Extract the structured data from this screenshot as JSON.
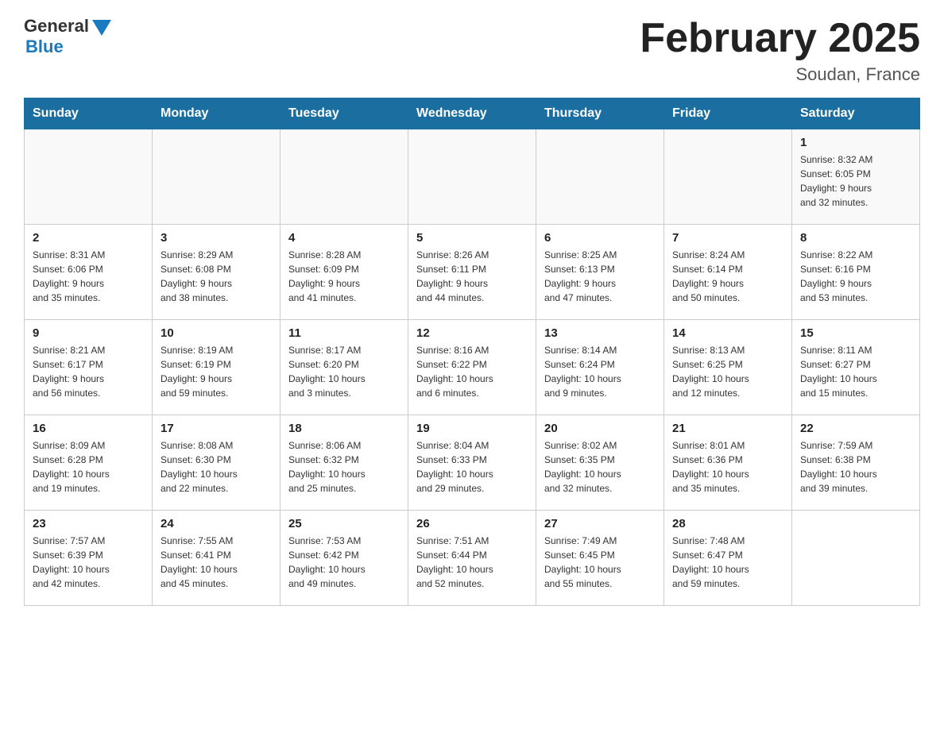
{
  "header": {
    "logo_general": "General",
    "logo_blue": "Blue",
    "month_title": "February 2025",
    "location": "Soudan, France"
  },
  "weekdays": [
    "Sunday",
    "Monday",
    "Tuesday",
    "Wednesday",
    "Thursday",
    "Friday",
    "Saturday"
  ],
  "weeks": [
    [
      {
        "day": "",
        "info": ""
      },
      {
        "day": "",
        "info": ""
      },
      {
        "day": "",
        "info": ""
      },
      {
        "day": "",
        "info": ""
      },
      {
        "day": "",
        "info": ""
      },
      {
        "day": "",
        "info": ""
      },
      {
        "day": "1",
        "info": "Sunrise: 8:32 AM\nSunset: 6:05 PM\nDaylight: 9 hours\nand 32 minutes."
      }
    ],
    [
      {
        "day": "2",
        "info": "Sunrise: 8:31 AM\nSunset: 6:06 PM\nDaylight: 9 hours\nand 35 minutes."
      },
      {
        "day": "3",
        "info": "Sunrise: 8:29 AM\nSunset: 6:08 PM\nDaylight: 9 hours\nand 38 minutes."
      },
      {
        "day": "4",
        "info": "Sunrise: 8:28 AM\nSunset: 6:09 PM\nDaylight: 9 hours\nand 41 minutes."
      },
      {
        "day": "5",
        "info": "Sunrise: 8:26 AM\nSunset: 6:11 PM\nDaylight: 9 hours\nand 44 minutes."
      },
      {
        "day": "6",
        "info": "Sunrise: 8:25 AM\nSunset: 6:13 PM\nDaylight: 9 hours\nand 47 minutes."
      },
      {
        "day": "7",
        "info": "Sunrise: 8:24 AM\nSunset: 6:14 PM\nDaylight: 9 hours\nand 50 minutes."
      },
      {
        "day": "8",
        "info": "Sunrise: 8:22 AM\nSunset: 6:16 PM\nDaylight: 9 hours\nand 53 minutes."
      }
    ],
    [
      {
        "day": "9",
        "info": "Sunrise: 8:21 AM\nSunset: 6:17 PM\nDaylight: 9 hours\nand 56 minutes."
      },
      {
        "day": "10",
        "info": "Sunrise: 8:19 AM\nSunset: 6:19 PM\nDaylight: 9 hours\nand 59 minutes."
      },
      {
        "day": "11",
        "info": "Sunrise: 8:17 AM\nSunset: 6:20 PM\nDaylight: 10 hours\nand 3 minutes."
      },
      {
        "day": "12",
        "info": "Sunrise: 8:16 AM\nSunset: 6:22 PM\nDaylight: 10 hours\nand 6 minutes."
      },
      {
        "day": "13",
        "info": "Sunrise: 8:14 AM\nSunset: 6:24 PM\nDaylight: 10 hours\nand 9 minutes."
      },
      {
        "day": "14",
        "info": "Sunrise: 8:13 AM\nSunset: 6:25 PM\nDaylight: 10 hours\nand 12 minutes."
      },
      {
        "day": "15",
        "info": "Sunrise: 8:11 AM\nSunset: 6:27 PM\nDaylight: 10 hours\nand 15 minutes."
      }
    ],
    [
      {
        "day": "16",
        "info": "Sunrise: 8:09 AM\nSunset: 6:28 PM\nDaylight: 10 hours\nand 19 minutes."
      },
      {
        "day": "17",
        "info": "Sunrise: 8:08 AM\nSunset: 6:30 PM\nDaylight: 10 hours\nand 22 minutes."
      },
      {
        "day": "18",
        "info": "Sunrise: 8:06 AM\nSunset: 6:32 PM\nDaylight: 10 hours\nand 25 minutes."
      },
      {
        "day": "19",
        "info": "Sunrise: 8:04 AM\nSunset: 6:33 PM\nDaylight: 10 hours\nand 29 minutes."
      },
      {
        "day": "20",
        "info": "Sunrise: 8:02 AM\nSunset: 6:35 PM\nDaylight: 10 hours\nand 32 minutes."
      },
      {
        "day": "21",
        "info": "Sunrise: 8:01 AM\nSunset: 6:36 PM\nDaylight: 10 hours\nand 35 minutes."
      },
      {
        "day": "22",
        "info": "Sunrise: 7:59 AM\nSunset: 6:38 PM\nDaylight: 10 hours\nand 39 minutes."
      }
    ],
    [
      {
        "day": "23",
        "info": "Sunrise: 7:57 AM\nSunset: 6:39 PM\nDaylight: 10 hours\nand 42 minutes."
      },
      {
        "day": "24",
        "info": "Sunrise: 7:55 AM\nSunset: 6:41 PM\nDaylight: 10 hours\nand 45 minutes."
      },
      {
        "day": "25",
        "info": "Sunrise: 7:53 AM\nSunset: 6:42 PM\nDaylight: 10 hours\nand 49 minutes."
      },
      {
        "day": "26",
        "info": "Sunrise: 7:51 AM\nSunset: 6:44 PM\nDaylight: 10 hours\nand 52 minutes."
      },
      {
        "day": "27",
        "info": "Sunrise: 7:49 AM\nSunset: 6:45 PM\nDaylight: 10 hours\nand 55 minutes."
      },
      {
        "day": "28",
        "info": "Sunrise: 7:48 AM\nSunset: 6:47 PM\nDaylight: 10 hours\nand 59 minutes."
      },
      {
        "day": "",
        "info": ""
      }
    ]
  ]
}
